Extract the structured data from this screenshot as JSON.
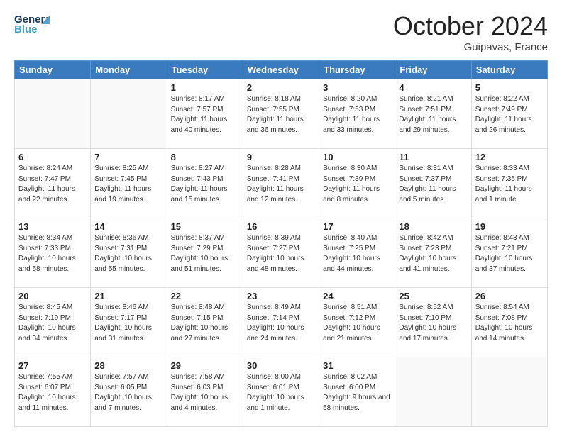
{
  "header": {
    "logo_general": "General",
    "logo_blue": "Blue",
    "month_title": "October 2024",
    "location": "Guipavas, France"
  },
  "weekdays": [
    "Sunday",
    "Monday",
    "Tuesday",
    "Wednesday",
    "Thursday",
    "Friday",
    "Saturday"
  ],
  "weeks": [
    [
      {
        "day": "",
        "info": ""
      },
      {
        "day": "",
        "info": ""
      },
      {
        "day": "1",
        "info": "Sunrise: 8:17 AM\nSunset: 7:57 PM\nDaylight: 11 hours and 40 minutes."
      },
      {
        "day": "2",
        "info": "Sunrise: 8:18 AM\nSunset: 7:55 PM\nDaylight: 11 hours and 36 minutes."
      },
      {
        "day": "3",
        "info": "Sunrise: 8:20 AM\nSunset: 7:53 PM\nDaylight: 11 hours and 33 minutes."
      },
      {
        "day": "4",
        "info": "Sunrise: 8:21 AM\nSunset: 7:51 PM\nDaylight: 11 hours and 29 minutes."
      },
      {
        "day": "5",
        "info": "Sunrise: 8:22 AM\nSunset: 7:49 PM\nDaylight: 11 hours and 26 minutes."
      }
    ],
    [
      {
        "day": "6",
        "info": "Sunrise: 8:24 AM\nSunset: 7:47 PM\nDaylight: 11 hours and 22 minutes."
      },
      {
        "day": "7",
        "info": "Sunrise: 8:25 AM\nSunset: 7:45 PM\nDaylight: 11 hours and 19 minutes."
      },
      {
        "day": "8",
        "info": "Sunrise: 8:27 AM\nSunset: 7:43 PM\nDaylight: 11 hours and 15 minutes."
      },
      {
        "day": "9",
        "info": "Sunrise: 8:28 AM\nSunset: 7:41 PM\nDaylight: 11 hours and 12 minutes."
      },
      {
        "day": "10",
        "info": "Sunrise: 8:30 AM\nSunset: 7:39 PM\nDaylight: 11 hours and 8 minutes."
      },
      {
        "day": "11",
        "info": "Sunrise: 8:31 AM\nSunset: 7:37 PM\nDaylight: 11 hours and 5 minutes."
      },
      {
        "day": "12",
        "info": "Sunrise: 8:33 AM\nSunset: 7:35 PM\nDaylight: 11 hours and 1 minute."
      }
    ],
    [
      {
        "day": "13",
        "info": "Sunrise: 8:34 AM\nSunset: 7:33 PM\nDaylight: 10 hours and 58 minutes."
      },
      {
        "day": "14",
        "info": "Sunrise: 8:36 AM\nSunset: 7:31 PM\nDaylight: 10 hours and 55 minutes."
      },
      {
        "day": "15",
        "info": "Sunrise: 8:37 AM\nSunset: 7:29 PM\nDaylight: 10 hours and 51 minutes."
      },
      {
        "day": "16",
        "info": "Sunrise: 8:39 AM\nSunset: 7:27 PM\nDaylight: 10 hours and 48 minutes."
      },
      {
        "day": "17",
        "info": "Sunrise: 8:40 AM\nSunset: 7:25 PM\nDaylight: 10 hours and 44 minutes."
      },
      {
        "day": "18",
        "info": "Sunrise: 8:42 AM\nSunset: 7:23 PM\nDaylight: 10 hours and 41 minutes."
      },
      {
        "day": "19",
        "info": "Sunrise: 8:43 AM\nSunset: 7:21 PM\nDaylight: 10 hours and 37 minutes."
      }
    ],
    [
      {
        "day": "20",
        "info": "Sunrise: 8:45 AM\nSunset: 7:19 PM\nDaylight: 10 hours and 34 minutes."
      },
      {
        "day": "21",
        "info": "Sunrise: 8:46 AM\nSunset: 7:17 PM\nDaylight: 10 hours and 31 minutes."
      },
      {
        "day": "22",
        "info": "Sunrise: 8:48 AM\nSunset: 7:15 PM\nDaylight: 10 hours and 27 minutes."
      },
      {
        "day": "23",
        "info": "Sunrise: 8:49 AM\nSunset: 7:14 PM\nDaylight: 10 hours and 24 minutes."
      },
      {
        "day": "24",
        "info": "Sunrise: 8:51 AM\nSunset: 7:12 PM\nDaylight: 10 hours and 21 minutes."
      },
      {
        "day": "25",
        "info": "Sunrise: 8:52 AM\nSunset: 7:10 PM\nDaylight: 10 hours and 17 minutes."
      },
      {
        "day": "26",
        "info": "Sunrise: 8:54 AM\nSunset: 7:08 PM\nDaylight: 10 hours and 14 minutes."
      }
    ],
    [
      {
        "day": "27",
        "info": "Sunrise: 7:55 AM\nSunset: 6:07 PM\nDaylight: 10 hours and 11 minutes."
      },
      {
        "day": "28",
        "info": "Sunrise: 7:57 AM\nSunset: 6:05 PM\nDaylight: 10 hours and 7 minutes."
      },
      {
        "day": "29",
        "info": "Sunrise: 7:58 AM\nSunset: 6:03 PM\nDaylight: 10 hours and 4 minutes."
      },
      {
        "day": "30",
        "info": "Sunrise: 8:00 AM\nSunset: 6:01 PM\nDaylight: 10 hours and 1 minute."
      },
      {
        "day": "31",
        "info": "Sunrise: 8:02 AM\nSunset: 6:00 PM\nDaylight: 9 hours and 58 minutes."
      },
      {
        "day": "",
        "info": ""
      },
      {
        "day": "",
        "info": ""
      }
    ]
  ]
}
